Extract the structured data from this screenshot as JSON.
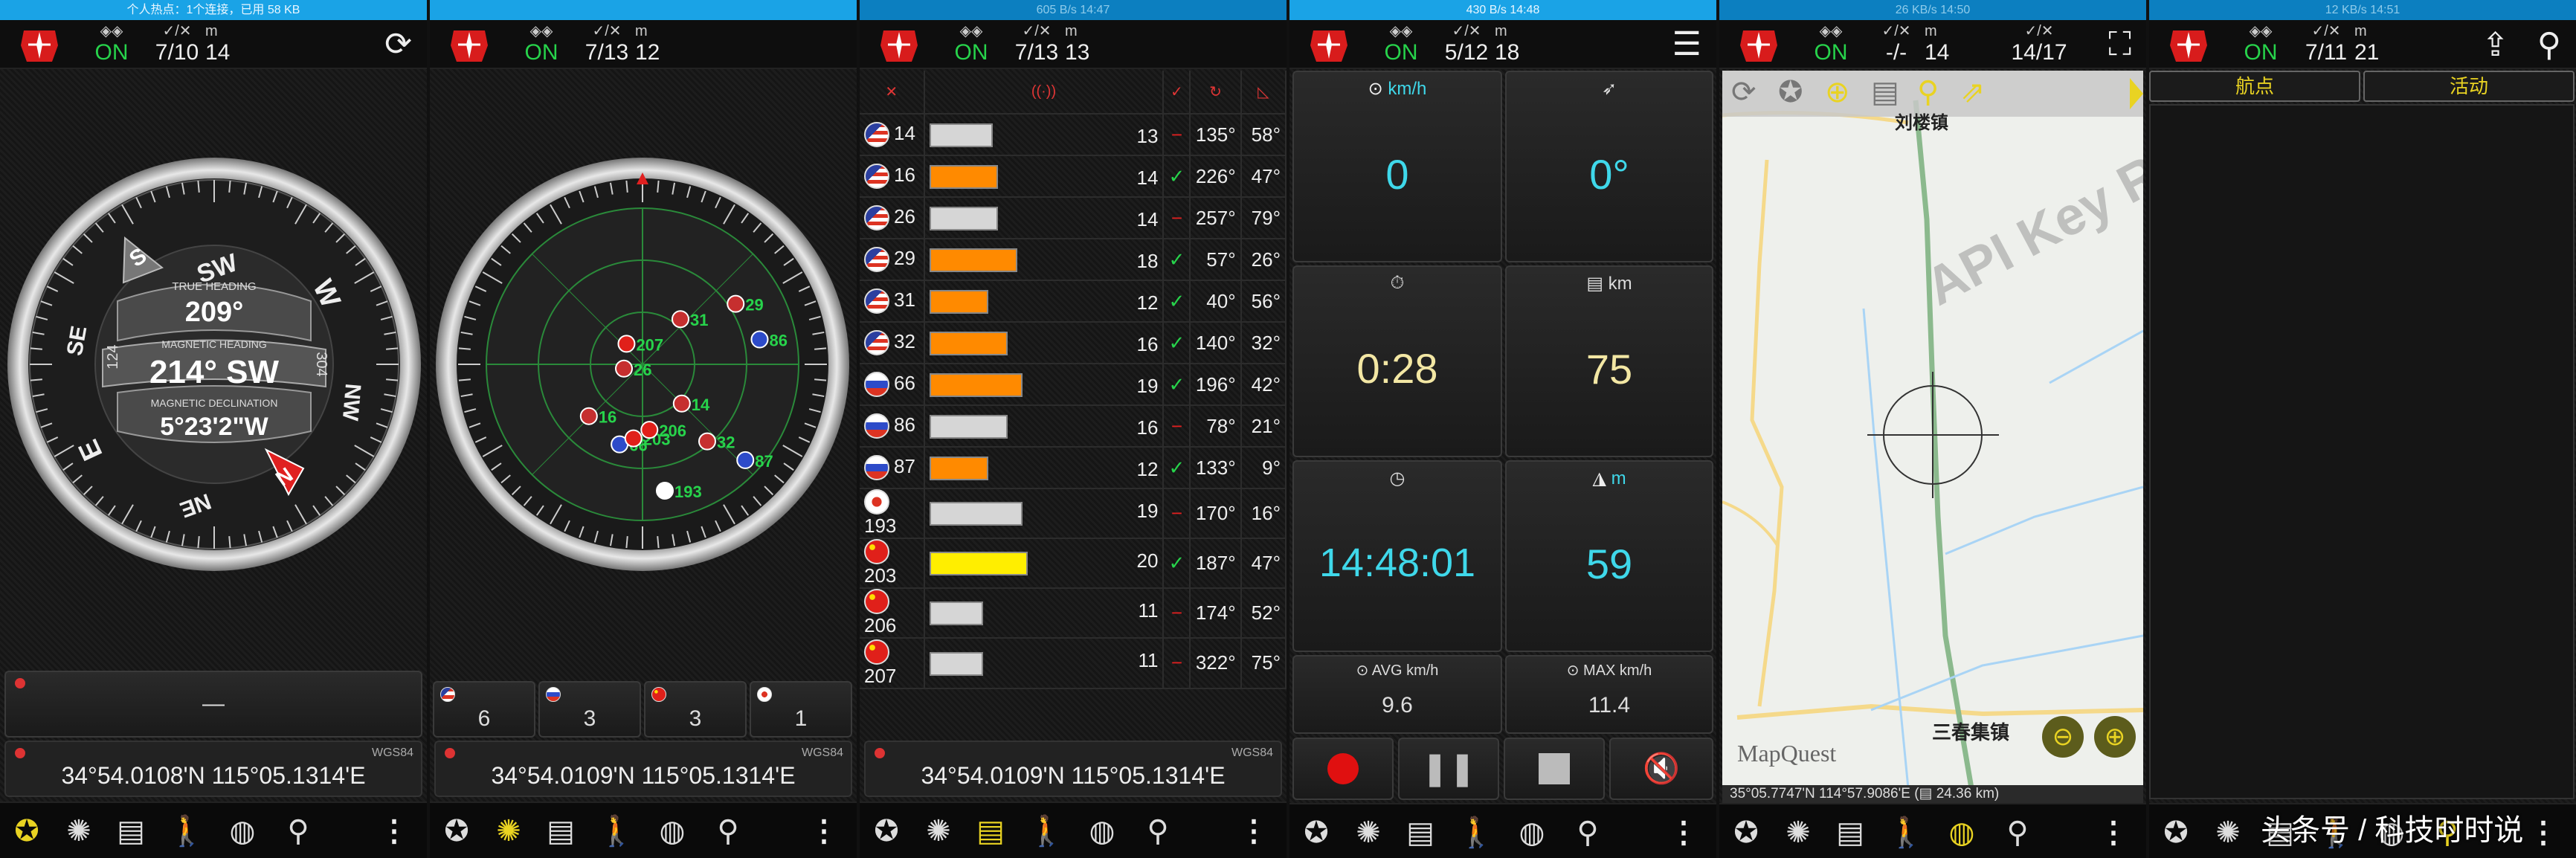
{
  "colors": {
    "accent": "#1aa3e6",
    "on": "#27d34b",
    "yellow": "#e9d322",
    "red": "#e02020",
    "cyan": "#3fd8ea"
  },
  "panels": [
    {
      "statusbar": "个人热点：1个连接，已用 58 KB",
      "gps": "ON",
      "sats": "7/10",
      "alt_unit": "m",
      "alt": "14"
    },
    {
      "statusbar": "",
      "gps": "ON",
      "sats": "7/13",
      "alt_unit": "m",
      "alt": "12"
    },
    {
      "statusbar": "605 B/s  14:47",
      "gps": "ON",
      "sats": "7/13",
      "alt_unit": "m",
      "alt": "13"
    },
    {
      "statusbar": "430 B/s  14:48",
      "gps": "ON",
      "sats": "5/12",
      "alt_unit": "m",
      "alt": "18"
    },
    {
      "statusbar": "26 KB/s  14:50",
      "gps": "ON",
      "sats": "-/-",
      "alt_unit": "m",
      "alt": "14",
      "extra": "14/17"
    },
    {
      "statusbar": "12 KB/s  14:51",
      "gps": "ON",
      "sats": "7/11",
      "alt_unit": "m",
      "alt": "21"
    }
  ],
  "compass": {
    "true_heading_label": "TRUE HEADING",
    "true_heading": "209°",
    "magnetic_heading_label": "MAGNETIC HEADING",
    "magnetic_heading": "214° SW",
    "declination_label": "MAGNETIC DECLINATION",
    "declination": "5°23'2\"W",
    "ring": [
      "SW",
      "W",
      "NW",
      "N",
      "NE",
      "E",
      "SE",
      "S"
    ],
    "left_val": "124",
    "right_val": "304",
    "placeholder": "—"
  },
  "sky": {
    "counts": [
      {
        "flag": "us",
        "n": "6"
      },
      {
        "flag": "ru",
        "n": "3"
      },
      {
        "flag": "cn",
        "n": "3"
      },
      {
        "flag": "jp",
        "n": "1"
      }
    ],
    "sats": [
      {
        "id": "193",
        "c": "jp"
      },
      {
        "id": "66",
        "c": "ru"
      },
      {
        "id": "203",
        "c": "cn"
      },
      {
        "id": "16",
        "c": "us"
      },
      {
        "id": "206",
        "c": "cn"
      },
      {
        "id": "87",
        "c": "ru"
      },
      {
        "id": "32",
        "c": "us"
      },
      {
        "id": "14",
        "c": "us"
      },
      {
        "id": "26",
        "c": "us"
      },
      {
        "id": "207",
        "c": "cn"
      },
      {
        "id": "31",
        "c": "us"
      },
      {
        "id": "86",
        "c": "ru"
      },
      {
        "id": "29",
        "c": "us"
      }
    ]
  },
  "coords_text": "34°54.0108'N   115°05.1314'E",
  "coords_text2": "34°54.0109'N   115°05.1314'E",
  "datum": "WGS84",
  "sat_table": {
    "rows": [
      {
        "c": "us",
        "id": "14",
        "snr": 13,
        "used": false,
        "az": "135°",
        "el": "58°"
      },
      {
        "c": "us",
        "id": "16",
        "snr": 14,
        "used": true,
        "az": "226°",
        "el": "47°"
      },
      {
        "c": "us",
        "id": "26",
        "snr": 14,
        "used": false,
        "az": "257°",
        "el": "79°"
      },
      {
        "c": "us",
        "id": "29",
        "snr": 18,
        "used": true,
        "az": "57°",
        "el": "26°"
      },
      {
        "c": "us",
        "id": "31",
        "snr": 12,
        "used": true,
        "az": "40°",
        "el": "56°"
      },
      {
        "c": "us",
        "id": "32",
        "snr": 16,
        "used": true,
        "az": "140°",
        "el": "32°"
      },
      {
        "c": "ru",
        "id": "66",
        "snr": 19,
        "used": true,
        "az": "196°",
        "el": "42°"
      },
      {
        "c": "ru",
        "id": "86",
        "snr": 16,
        "used": false,
        "az": "78°",
        "el": "21°"
      },
      {
        "c": "ru",
        "id": "87",
        "snr": 12,
        "used": true,
        "az": "133°",
        "el": "9°"
      },
      {
        "c": "jp",
        "id": "193",
        "snr": 19,
        "used": false,
        "az": "170°",
        "el": "16°"
      },
      {
        "c": "cn",
        "id": "203",
        "snr": 20,
        "used": true,
        "az": "187°",
        "el": "47°"
      },
      {
        "c": "cn",
        "id": "206",
        "snr": 11,
        "used": false,
        "az": "174°",
        "el": "52°"
      },
      {
        "c": "cn",
        "id": "207",
        "snr": 11,
        "used": false,
        "az": "322°",
        "el": "75°"
      }
    ]
  },
  "trip": {
    "speed_unit": "km/h",
    "speed": "0",
    "heading": "0°",
    "time": "0:28",
    "dist_unit": "km",
    "dist": "75",
    "clock": "14:48:01",
    "alt_unit": "m",
    "alt": "59",
    "avg_label": "AVG km/h",
    "avg": "9.6",
    "max_label": "MAX km/h",
    "max": "11.4"
  },
  "map": {
    "town1": "刘楼镇",
    "town2": "三春集镇",
    "watermark": "API Key Re",
    "brand": "MapQuest",
    "status": "35°05.7747'N   114°57.9086'E   (▤ 24.36 km)"
  },
  "waypoints": {
    "tab1": "航点",
    "tab2": "活动"
  },
  "overlay_caption": "头条号 / 科技时时说"
}
